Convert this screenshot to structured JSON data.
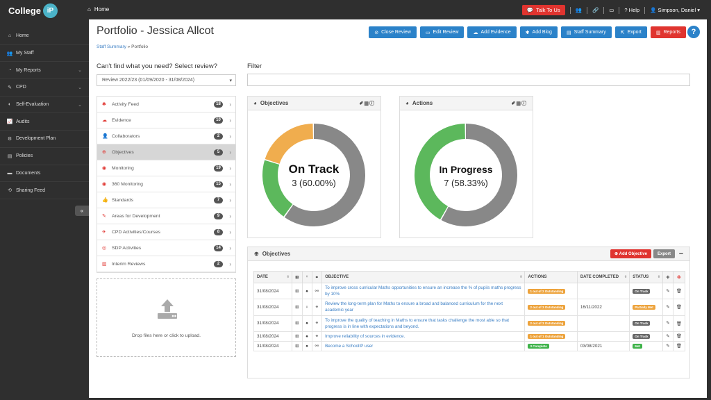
{
  "brand": {
    "name": "College",
    "ip": "iP"
  },
  "topnav": {
    "home": "Home",
    "talk": "Talk To Us",
    "help": "Help",
    "user": "Simpson, Daniel"
  },
  "sidebar": {
    "items": [
      {
        "label": "Home",
        "icon": "home-icon",
        "glyph": "⌂",
        "chev": false
      },
      {
        "label": "My Staff",
        "icon": "staff-icon",
        "glyph": "👥",
        "chev": false
      },
      {
        "label": "My Reports",
        "icon": "reports-icon",
        "glyph": "◔",
        "chev": true
      },
      {
        "label": "CPD",
        "icon": "cpd-icon",
        "glyph": "✎",
        "chev": true
      },
      {
        "label": "Self-Evaluation",
        "icon": "self-eval-icon",
        "glyph": "◐",
        "chev": true
      },
      {
        "label": "Audits",
        "icon": "audits-icon",
        "glyph": "📈",
        "chev": false
      },
      {
        "label": "Development Plan",
        "icon": "dev-plan-icon",
        "glyph": "⚙",
        "chev": false
      },
      {
        "label": "Policies",
        "icon": "policies-icon",
        "glyph": "▤",
        "chev": false
      },
      {
        "label": "Documents",
        "icon": "documents-icon",
        "glyph": "▬",
        "chev": false
      },
      {
        "label": "Sharing Feed",
        "icon": "share-icon",
        "glyph": "⟲",
        "chev": false
      }
    ]
  },
  "page": {
    "title": "Portfolio - Jessica Allcot",
    "breadcrumb_link": "Staff Summary",
    "breadcrumb_sep": " » ",
    "breadcrumb_current": "Portfolio"
  },
  "buttons": {
    "close_review": "Close Review",
    "edit_review": "Edit Review",
    "add_evidence": "Add Evidence",
    "add_blog": "Add Blog",
    "staff_summary": "Staff Summary",
    "export": "Export",
    "reports": "Reports",
    "help": "?"
  },
  "review": {
    "label": "Can't find what you need? Select review?",
    "selected": "Review 2022/23 (01/09/2020 - 31/08/2024)"
  },
  "filter": {
    "label": "Filter"
  },
  "menu": [
    {
      "label": "Activity Feed",
      "count": "18",
      "glyph": "✱"
    },
    {
      "label": "Evidence",
      "count": "10",
      "glyph": "☁"
    },
    {
      "label": "Collaborators",
      "count": "2",
      "glyph": "👤"
    },
    {
      "label": "Objectives",
      "count": "5",
      "glyph": "⊕",
      "active": true
    },
    {
      "label": "Monitoring",
      "count": "19",
      "glyph": "◉"
    },
    {
      "label": "360 Monitoring",
      "count": "15",
      "glyph": "◉"
    },
    {
      "label": "Standards",
      "count": "7",
      "glyph": "👍"
    },
    {
      "label": "Areas for Development",
      "count": "9",
      "glyph": "✎"
    },
    {
      "label": "CPD Activities/Courses",
      "count": "8",
      "glyph": "✈"
    },
    {
      "label": "SDP Activities",
      "count": "14",
      "glyph": "◎"
    },
    {
      "label": "Interim Reviews",
      "count": "2",
      "glyph": "▥"
    }
  ],
  "dropzone": {
    "text": "Drop files here or click to upload."
  },
  "objectives_chart": {
    "title": "Objectives",
    "status": "On Track",
    "value": "3 (60.00%)",
    "segments": [
      {
        "label": "grey",
        "value": 60,
        "color": "#888888"
      },
      {
        "label": "green",
        "value": 20,
        "color": "#5cb85c"
      },
      {
        "label": "orange",
        "value": 20,
        "color": "#f0ad4e"
      }
    ]
  },
  "actions_chart": {
    "title": "Actions",
    "status": "In Progress",
    "value": "7 (58.33%)",
    "segments": [
      {
        "label": "grey",
        "value": 58.33,
        "color": "#888888"
      },
      {
        "label": "green",
        "value": 41.67,
        "color": "#5cb85c"
      }
    ]
  },
  "objectives_table": {
    "title": "Objectives",
    "add_label": "Add Objective",
    "export_label": "Export",
    "headers": {
      "date": "DATE",
      "objective": "OBJECTIVE",
      "actions": "ACTIONS",
      "date_completed": "DATE COMPLETED",
      "status": "STATUS"
    },
    "rows": [
      {
        "date": "31/08/2024",
        "objective": "To improve cross curricular Maths opportunities to ensure an increase the % of pupils maths progress by 10%",
        "actions": "1 out of 2 Outstanding",
        "actions_color": "orange",
        "completed": "",
        "status": "On Track",
        "status_color": "grey"
      },
      {
        "date": "31/08/2024",
        "objective": "Review the long-term plan for Maths to ensure a broad and balanced curriculum for the next academic year",
        "actions": "2 out of 3 Outstanding",
        "actions_color": "orange",
        "completed": "16/11/2022",
        "status": "Partially Met",
        "status_color": "orange"
      },
      {
        "date": "31/08/2024",
        "objective": "To improve the quality of teaching in Maths to ensure that tasks challenge the most able so that progress is in line with expectations and beyond.",
        "actions": "2 out of 3 Outstanding",
        "actions_color": "orange",
        "completed": "",
        "status": "On Track",
        "status_color": "grey"
      },
      {
        "date": "31/08/2024",
        "objective": "Improve reliability of sources in evidence.",
        "actions": "1 out of 1 Outstanding",
        "actions_color": "orange",
        "completed": "",
        "status": "On Track",
        "status_color": "grey"
      },
      {
        "date": "31/08/2024",
        "objective": "Become a SchoolIP user",
        "actions": "3 Complete",
        "actions_color": "green",
        "completed": "03/08/2021",
        "status": "Met",
        "status_color": "green"
      }
    ]
  }
}
